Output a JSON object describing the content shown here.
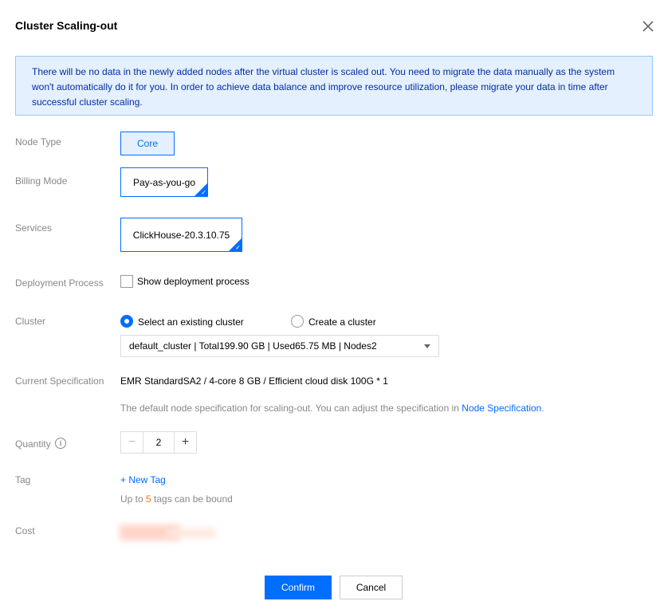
{
  "dialog": {
    "title": "Cluster Scaling-out",
    "close_icon": "close-icon"
  },
  "alert": {
    "text": "There will be no data in the newly added nodes after the virtual cluster is scaled out. You need to migrate the data manually as the system won't automatically do it for you. In order to achieve data balance and improve resource utilization, please migrate your data in time after successful cluster scaling."
  },
  "form": {
    "node_type": {
      "label": "Node Type",
      "value": "Core"
    },
    "billing_mode": {
      "label": "Billing Mode",
      "value": "Pay-as-you-go"
    },
    "services": {
      "label": "Services",
      "value": "ClickHouse-20.3.10.75"
    },
    "deployment_process": {
      "label": "Deployment Process",
      "checkbox_label": "Show deployment process",
      "checked": false
    },
    "cluster": {
      "label": "Cluster",
      "option_existing": "Select an existing cluster",
      "option_create": "Create a cluster",
      "selected": "existing",
      "select_value": "default_cluster | Total199.90 GB | Used65.75 MB | Nodes2"
    },
    "current_spec": {
      "label": "Current Specification",
      "value": "EMR StandardSA2 / 4-core 8 GB / Efficient cloud disk 100G * 1",
      "hint_prefix": "The default node specification for scaling-out. You can adjust the specification in ",
      "hint_link": "Node Specification",
      "hint_suffix": "."
    },
    "quantity": {
      "label": "Quantity",
      "value": "2",
      "minus": "−",
      "plus": "+",
      "info_glyph": "i"
    },
    "tag": {
      "label": "Tag",
      "new_tag": "+ New Tag",
      "hint_prefix": "Up to ",
      "hint_count": "5",
      "hint_suffix": " tags can be bound"
    },
    "cost": {
      "label": "Cost"
    }
  },
  "footer": {
    "confirm": "Confirm",
    "cancel": "Cancel"
  },
  "colors": {
    "accent": "#006eff",
    "alert_bg": "#e5f0ff",
    "alert_text": "#002da0",
    "label_gray": "#888888",
    "highlight_orange": "#ff7200"
  }
}
